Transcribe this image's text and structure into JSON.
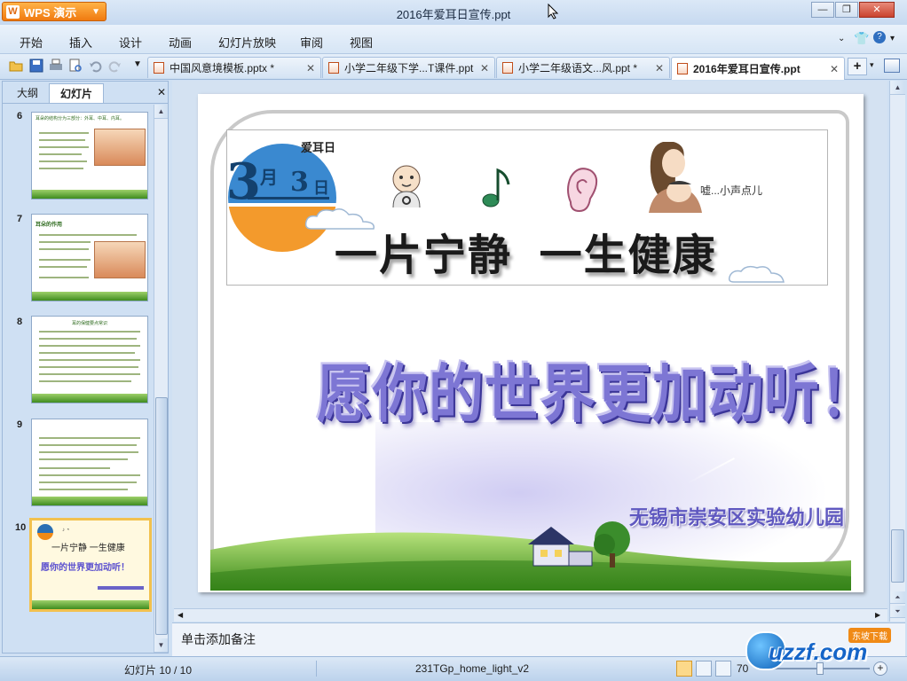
{
  "app": {
    "name": "WPS 演示",
    "window_title": "2016年爱耳日宣传.ppt"
  },
  "menu": [
    "开始",
    "插入",
    "设计",
    "动画",
    "幻灯片放映",
    "审阅",
    "视图"
  ],
  "tabs": [
    {
      "label": "中国风意境模板.pptx *"
    },
    {
      "label": "小学二年级下学...T课件.ppt"
    },
    {
      "label": "小学二年级语文...风.ppt *"
    },
    {
      "label": "2016年爱耳日宣传.ppt",
      "active": true
    }
  ],
  "panel": {
    "tab_outline": "大纲",
    "tab_slides": "幻灯片",
    "thumbnails": [
      {
        "num": "6",
        "title": "耳朵的结构分为三部分：外耳、中耳、内耳。"
      },
      {
        "num": "7",
        "title": "耳朵的作用"
      },
      {
        "num": "8",
        "title": "耳的保健要点常识"
      },
      {
        "num": "9",
        "title": ""
      },
      {
        "num": "10",
        "title": "一片宁静 一生健康",
        "subtitle": "愿你的世界更加动听！",
        "selected": true
      }
    ]
  },
  "slide": {
    "ear_day_label": "爱耳日",
    "date_month": "3",
    "date_month_unit": "月",
    "date_day": "3",
    "date_day_unit": "日",
    "whisper": "嘘...小声点儿",
    "headline": "一片宁静  一生健康",
    "wish": "愿你的世界更加动听！",
    "school": "无锡市崇安区实验幼儿园"
  },
  "notes": {
    "placeholder": "单击添加备注"
  },
  "status": {
    "slide_counter": "幻灯片 10 / 10",
    "template": "231TGp_home_light_v2",
    "zoom": "70"
  },
  "watermark": {
    "text": "uzzf.com",
    "tag": "东坡下载"
  },
  "colors": {
    "accent_orange": "#f08a16",
    "wish_text": "#6c63c8",
    "school_text": "#5b55b0",
    "grass": "#5fae2e"
  }
}
